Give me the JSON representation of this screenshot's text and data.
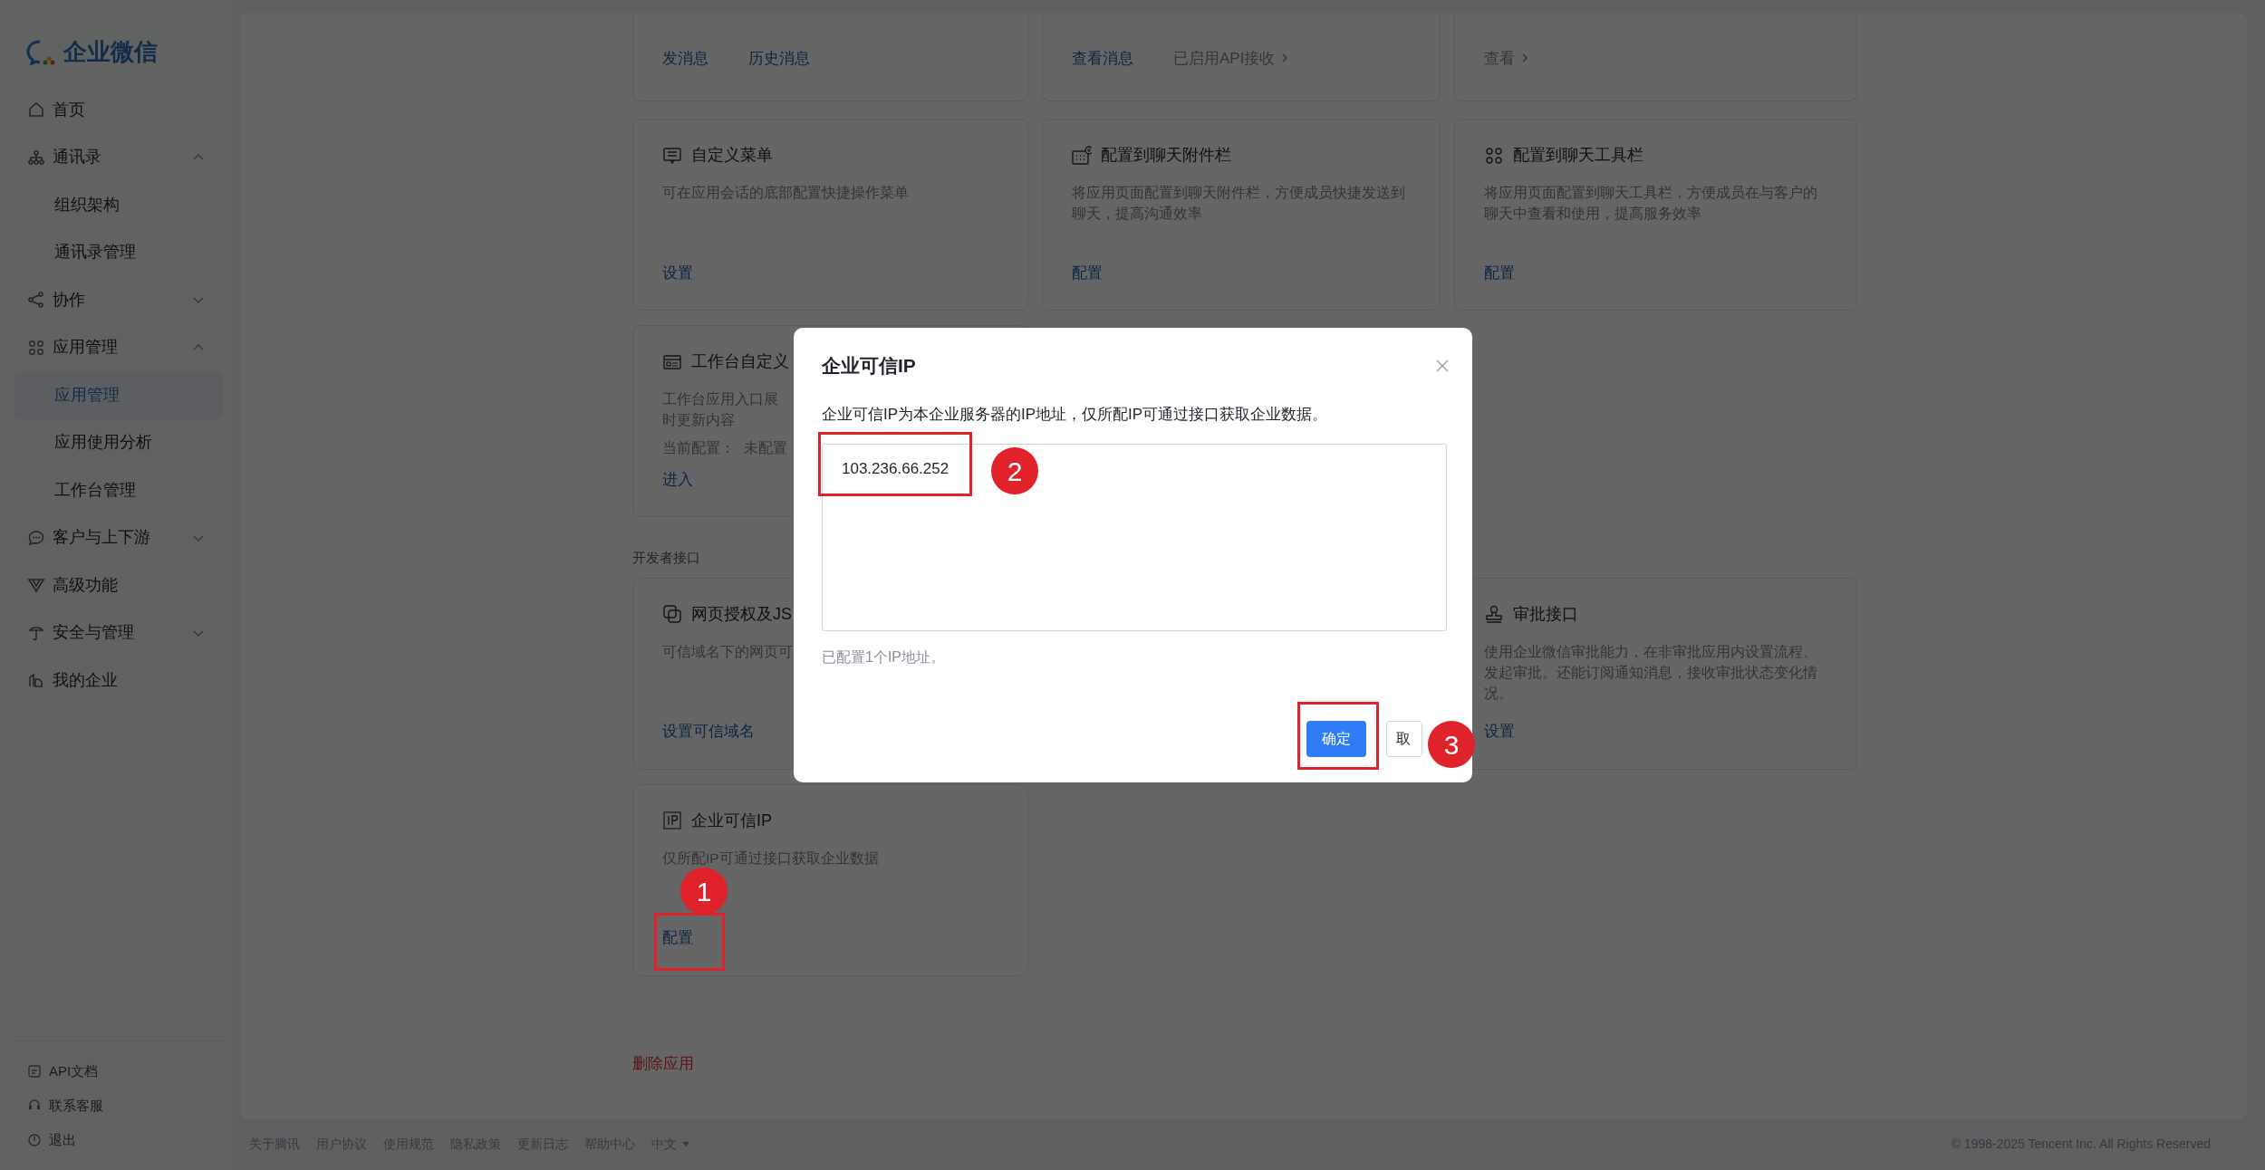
{
  "sidebar": {
    "logo": "企业微信",
    "items": [
      {
        "label": "首页",
        "selected": false
      },
      {
        "label": "通讯录",
        "selected": false,
        "expanded": true,
        "children": [
          {
            "label": "组织架构",
            "selected": false
          },
          {
            "label": "通讯录管理",
            "selected": false
          }
        ]
      },
      {
        "label": "协作",
        "selected": false,
        "expanded": false
      },
      {
        "label": "应用管理",
        "selected": false,
        "expanded": true,
        "children": [
          {
            "label": "应用管理",
            "selected": true
          },
          {
            "label": "应用使用分析",
            "selected": false
          },
          {
            "label": "工作台管理",
            "selected": false
          }
        ]
      },
      {
        "label": "客户与上下游",
        "selected": false,
        "expanded": false
      },
      {
        "label": "高级功能",
        "selected": false
      },
      {
        "label": "安全与管理",
        "selected": false,
        "expanded": false
      },
      {
        "label": "我的企业",
        "selected": false
      }
    ],
    "bottom_links": [
      "API文档",
      "联系客服",
      "退出"
    ]
  },
  "sections": [
    {
      "rows": [
        [
          {
            "links": [
              {
                "text": "发消息",
                "kind": "link"
              },
              {
                "text": "历史消息",
                "kind": "link"
              }
            ]
          },
          {
            "links": [
              {
                "text": "查看消息",
                "kind": "link"
              },
              {
                "text": "已启用API接收",
                "kind": "status"
              }
            ]
          },
          {
            "links": [
              {
                "text": "查看",
                "kind": "status"
              }
            ]
          }
        ],
        [
          {
            "title": "自定义菜单",
            "description": [
              "可在应用会话的底部配置快捷操作菜单"
            ],
            "links": [
              {
                "text": "设置",
                "kind": "link"
              }
            ]
          },
          {
            "title": "配置到聊天附件栏",
            "description": [
              "将应用页面配置到聊天附件栏，方便成员快捷发送到",
              "聊天，提高沟通效率"
            ],
            "links": [
              {
                "text": "配置",
                "kind": "link"
              }
            ]
          },
          {
            "title": "配置到聊天工具栏",
            "description": [
              "将应用页面配置到聊天工具栏，方便成员在与客户的",
              "聊天中查看和使用，提高服务效率"
            ],
            "links": [
              {
                "text": "配置",
                "kind": "link"
              }
            ]
          }
        ],
        [
          {
            "title": "工作台自定义",
            "description": [
              "工作台应用入口展",
              "时更新内容"
            ],
            "setting": {
              "label": "当前配置：",
              "value": "未配置"
            },
            "links": [
              {
                "text": "进入",
                "kind": "link"
              }
            ]
          }
        ]
      ]
    },
    {
      "heading": "开发者接口",
      "rows": [
        [
          {
            "title": "网页授权及JS",
            "description": [
              "可信域名下的网页可"
            ],
            "links": [
              {
                "text": "设置可信域名",
                "kind": "link"
              }
            ]
          },
          {
            "title": "审批接口",
            "description": [
              "使用企业微信审批能力，在非审批应用内设置流程、",
              "发起审批。还能订阅通知消息，接收审批状态变化情",
              "况。"
            ],
            "links": [
              {
                "text": "设置",
                "kind": "link"
              }
            ]
          }
        ],
        [
          {
            "title": "企业可信IP",
            "description": [
              "仅所配IP可通过接口获取企业数据"
            ],
            "links": [
              {
                "text": "配置",
                "kind": "link"
              }
            ]
          }
        ]
      ]
    }
  ],
  "danger_link": "删除应用",
  "footer": {
    "links": [
      "关于腾讯",
      "用户协议",
      "使用规范",
      "隐私政策",
      "更新日志",
      "帮助中心",
      "中文"
    ],
    "copyright": "© 1998-2025 Tencent Inc. All Rights Reserved"
  },
  "dialog": {
    "title": "企业可信IP",
    "description": "企业可信IP为本企业服务器的IP地址，仅所配IP可通过接口获取企业数据。",
    "value": "103.236.66.252",
    "hint": "已配置1个IP地址。",
    "buttons": [
      {
        "label": "确定",
        "kind": "primary"
      },
      {
        "label": "取",
        "kind": "secondary"
      }
    ]
  },
  "annotations": [
    "1",
    "2",
    "3"
  ]
}
